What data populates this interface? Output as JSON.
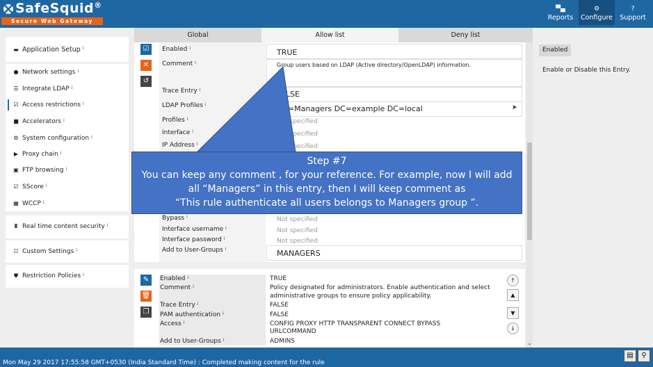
{
  "brand": {
    "name": "SafeSquid",
    "registered": "®",
    "tagline": "Secure Web Gateway"
  },
  "topnav": [
    {
      "label": "Reports",
      "icon": "bar-chart-icon"
    },
    {
      "label": "Configure",
      "icon": "gears-icon"
    },
    {
      "label": "Support",
      "icon": "question-icon"
    }
  ],
  "sidebar": {
    "app_setup": "Application Setup",
    "items": [
      "Network settings",
      "Integrate LDAP",
      "Access restrictions",
      "Accelerators",
      "System configuration",
      "Proxy chain",
      "FTP browsing",
      "SScore",
      "WCCP"
    ],
    "realtime": "Real time content security",
    "custom": "Custom Settings",
    "restriction": "Restriction Policies",
    "info_mark": "i"
  },
  "tabs": [
    "Global",
    "Allow list",
    "Deny list"
  ],
  "entry1": {
    "rows": [
      {
        "label": "Enabled",
        "value": "TRUE"
      },
      {
        "label": "Comment",
        "value": "Group users based on LDAP (Active directory/OpenLDAP) information."
      },
      {
        "label": "Trace Entry",
        "value": "FALSE"
      },
      {
        "label": "LDAP Profiles",
        "value": "CN=Managers DC=example DC=local"
      },
      {
        "label": "Profiles",
        "value": "Not specified"
      },
      {
        "label": "Interface",
        "value": "Not specified"
      },
      {
        "label": "IP Address",
        "value": "Not specified"
      },
      {
        "label": "Bypass",
        "value": "Not specified"
      },
      {
        "label": "Interface username",
        "value": "Not specified"
      },
      {
        "label": "Interface password",
        "value": "Not specified"
      },
      {
        "label": "Add to User-Groups",
        "value": "MANAGERS"
      }
    ]
  },
  "entry2": {
    "rows": [
      {
        "label": "Enabled",
        "value": "TRUE"
      },
      {
        "label": "Comment",
        "value": "Policy designated for administrators. Enable authentication and select",
        "value2": "administrative groups to ensure policy applicability."
      },
      {
        "label": "Trace Entry",
        "value": "FALSE"
      },
      {
        "label": "PAM authentication",
        "value": "FALSE"
      },
      {
        "label": "Access",
        "value": "CONFIG  PROXY  HTTP  TRANSPARENT  CONNECT  BYPASS",
        "value2": "URLCOMMAND"
      },
      {
        "label": "Add to User-Groups",
        "value": "ADMINS"
      }
    ]
  },
  "help": {
    "badge": "Enabled",
    "text": "Enable or Disable this Entry."
  },
  "tooltip": {
    "title": "Step #7",
    "line1": "You can keep any comment , for your reference. For example, now I will add",
    "line2": "all “Managers” in this entry, then I will keep comment as",
    "line3": "“This rule authenticate all users belongs to Managers group ”."
  },
  "status": "Mon May 29 2017 17:55:58 GMT+0530 (India Standard Time) : Completed making content for the rule",
  "colors": {
    "header": "#1f67a3",
    "accent": "#e8631a",
    "tooltip": "#4472c4"
  }
}
